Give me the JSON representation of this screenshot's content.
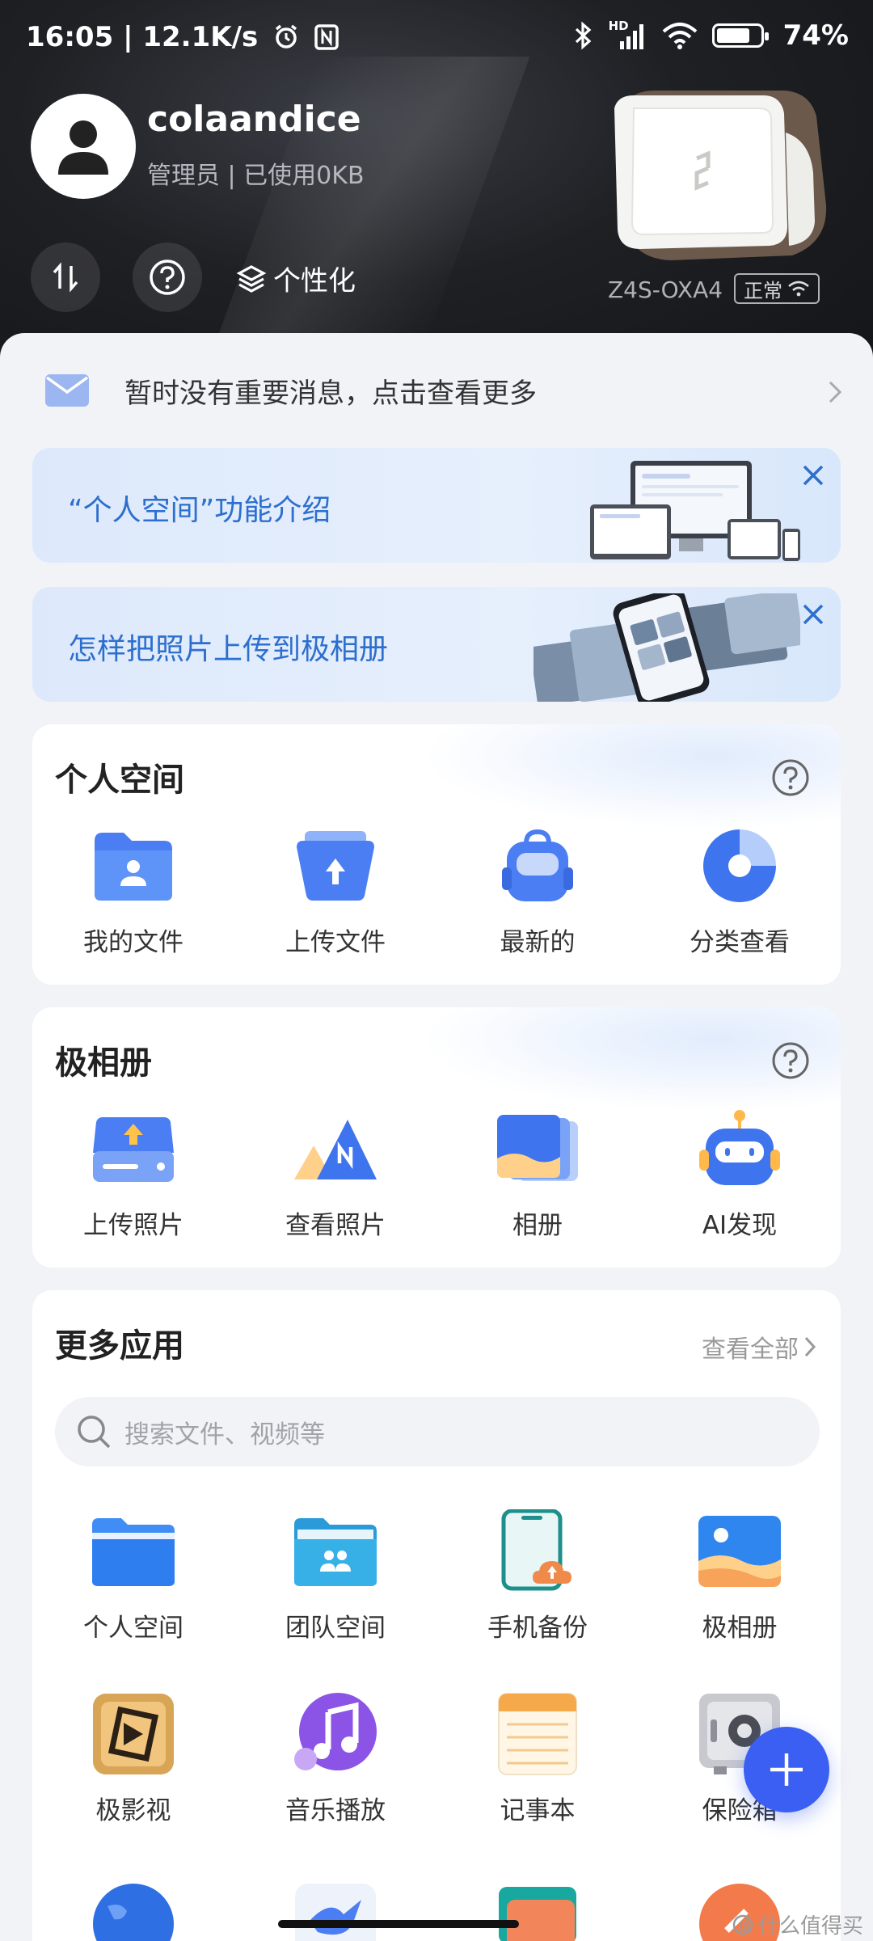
{
  "statusbar": {
    "time": "16:05",
    "network_speed": "12.1K/s",
    "battery": "74%",
    "net_label": "HD"
  },
  "profile": {
    "username": "colaandice",
    "role_usage": "管理员 | 已使用0KB"
  },
  "hero": {
    "personalize_label": "个性化"
  },
  "device": {
    "name": "Z4S-OXA4",
    "status": "正常"
  },
  "notice": {
    "text": "暂时没有重要消息，点击查看更多"
  },
  "banners": [
    {
      "text": "“个人空间”功能介绍"
    },
    {
      "text": "怎样把照片上传到极相册"
    }
  ],
  "personal_space": {
    "title": "个人空间",
    "items": [
      {
        "label": "我的文件",
        "icon": "folder-user-icon"
      },
      {
        "label": "上传文件",
        "icon": "upload-folder-icon"
      },
      {
        "label": "最新的",
        "icon": "backpack-icon"
      },
      {
        "label": "分类查看",
        "icon": "pie-chart-icon"
      }
    ]
  },
  "album": {
    "title": "极相册",
    "items": [
      {
        "label": "上传照片",
        "icon": "upload-drive-icon"
      },
      {
        "label": "查看照片",
        "icon": "mountain-icon"
      },
      {
        "label": "相册",
        "icon": "photo-stack-icon"
      },
      {
        "label": "AI发现",
        "icon": "robot-icon"
      }
    ]
  },
  "more_apps": {
    "title": "更多应用",
    "view_all": "查看全部",
    "search_placeholder": "搜索文件、视频等",
    "row1": [
      {
        "label": "个人空间",
        "icon": "folder-icon"
      },
      {
        "label": "团队空间",
        "icon": "team-folder-icon"
      },
      {
        "label": "手机备份",
        "icon": "phone-backup-icon"
      },
      {
        "label": "极相册",
        "icon": "landscape-photo-icon"
      }
    ],
    "row2": [
      {
        "label": "极影视",
        "icon": "film-icon"
      },
      {
        "label": "音乐播放",
        "icon": "music-note-icon"
      },
      {
        "label": "记事本",
        "icon": "notepad-icon"
      },
      {
        "label": "保险箱",
        "icon": "safe-icon"
      }
    ]
  },
  "watermark": "什么值得买",
  "colors": {
    "accent": "#3a5ff2",
    "banner_text": "#2d6fce",
    "hero_bg": "#1e2024"
  }
}
